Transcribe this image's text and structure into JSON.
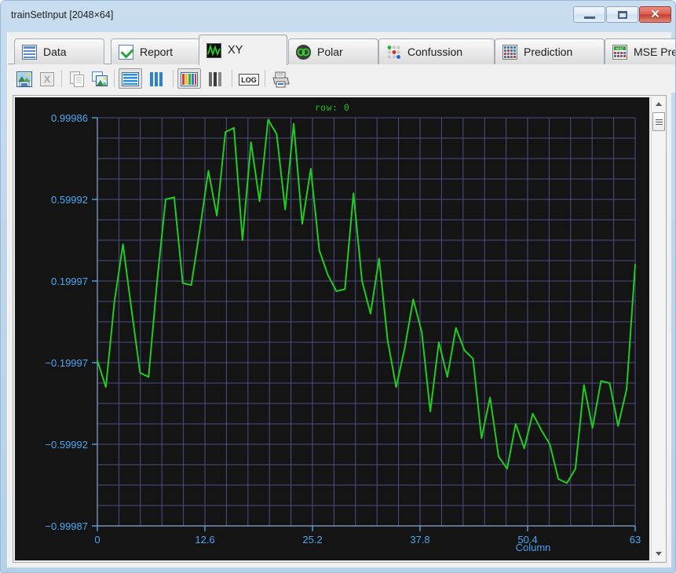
{
  "window": {
    "title": "trainSetInput [2048×64]",
    "buttons": {
      "minimize": "–",
      "maximize": "□",
      "close": "✕"
    }
  },
  "tabs": [
    {
      "id": "data",
      "label": "Data",
      "icon": "table-icon",
      "active": false
    },
    {
      "id": "report",
      "label": "Report",
      "icon": "check-icon",
      "active": false
    },
    {
      "id": "xy",
      "label": "XY",
      "icon": "xy-plot-icon",
      "active": true
    },
    {
      "id": "polar",
      "label": "Polar",
      "icon": "polar-icon",
      "active": false
    },
    {
      "id": "confussion",
      "label": "Confussion",
      "icon": "confusion-icon",
      "active": false
    },
    {
      "id": "prediction",
      "label": "Prediction",
      "icon": "prediction-icon",
      "active": false
    },
    {
      "id": "msepred",
      "label": "MSE Pred",
      "icon": "mse-icon",
      "active": false
    }
  ],
  "toolbar": [
    {
      "id": "save-image",
      "name": "save-image-button",
      "tooltip": "Save image",
      "enabled": true,
      "pressed": false
    },
    {
      "id": "export-excel",
      "name": "export-excel-button",
      "tooltip": "Export to Excel",
      "enabled": false,
      "pressed": false
    },
    {
      "id": "copy",
      "name": "copy-button",
      "tooltip": "Copy",
      "enabled": false,
      "pressed": false
    },
    {
      "id": "copy-image",
      "name": "copy-image-button",
      "tooltip": "Copy image",
      "enabled": true,
      "pressed": false
    },
    {
      "id": "lines-view",
      "name": "horizontal-lines-button",
      "tooltip": "Lines",
      "enabled": true,
      "pressed": true
    },
    {
      "id": "columns-view",
      "name": "vertical-bars-button",
      "tooltip": "Columns",
      "enabled": true,
      "pressed": false
    },
    {
      "id": "color-map",
      "name": "color-bars-button",
      "tooltip": "Color",
      "enabled": true,
      "pressed": true
    },
    {
      "id": "gray-map",
      "name": "gray-bars-button",
      "tooltip": "Grayscale",
      "enabled": true,
      "pressed": false
    },
    {
      "id": "log-scale",
      "name": "log-scale-button",
      "label": "LOG",
      "enabled": true,
      "pressed": false
    },
    {
      "id": "print",
      "name": "print-button",
      "tooltip": "Print",
      "enabled": true,
      "pressed": false
    }
  ],
  "scrollbar": {
    "up_arrow": "▲",
    "down_arrow": "▼",
    "position": "top"
  },
  "colors": {
    "plot_background": "#141414",
    "grid": "#4e4e86",
    "axis_text": "#4aa8f0",
    "series": "#1fcc1f",
    "annotation": "#18c21c",
    "title_bar": "#bfd6ec",
    "close_button": "#c63e2d"
  },
  "chart_data": {
    "type": "line",
    "title": "row: 0",
    "xlabel": "Column",
    "ylabel": "",
    "grid": true,
    "legend": false,
    "xlim": [
      0,
      63
    ],
    "ylim": [
      -0.99987,
      0.99986
    ],
    "xticks": [
      0,
      12.6,
      25.2,
      37.8,
      50.4,
      63
    ],
    "xtick_labels": [
      "0",
      "12.6",
      "25.2",
      "37.8",
      "50.4",
      "63"
    ],
    "yticks": [
      0.99986,
      0.59992,
      0.19997,
      -0.19997,
      -0.59992,
      -0.99987
    ],
    "ytick_labels": [
      "0.99986",
      "0.59992",
      "0.19997",
      "−0.19997",
      "−0.59992",
      "−0.99987"
    ],
    "series": [
      {
        "name": "row 0",
        "color": "#1fcc1f",
        "x": [
          0,
          1,
          2,
          3,
          4,
          5,
          6,
          7,
          8,
          9,
          10,
          11,
          12,
          13,
          14,
          15,
          16,
          17,
          18,
          19,
          20,
          21,
          22,
          23,
          24,
          25,
          26,
          27,
          28,
          29,
          30,
          31,
          32,
          33,
          34,
          35,
          36,
          37,
          38,
          39,
          40,
          41,
          42,
          43,
          44,
          45,
          46,
          47,
          48,
          49,
          50,
          51,
          52,
          53,
          54,
          55,
          56,
          57,
          58,
          59,
          60,
          61,
          62,
          63
        ],
        "values": [
          -0.19,
          -0.32,
          0.1,
          0.38,
          0.06,
          -0.25,
          -0.27,
          0.2,
          0.6,
          0.61,
          0.19,
          0.18,
          0.45,
          0.74,
          0.52,
          0.93,
          0.95,
          0.4,
          0.88,
          0.59,
          0.99,
          0.92,
          0.55,
          0.97,
          0.48,
          0.75,
          0.35,
          0.23,
          0.15,
          0.16,
          0.63,
          0.2,
          0.04,
          0.31,
          -0.09,
          -0.32,
          -0.13,
          0.11,
          -0.05,
          -0.44,
          -0.1,
          -0.27,
          -0.03,
          -0.14,
          -0.18,
          -0.57,
          -0.37,
          -0.66,
          -0.72,
          -0.5,
          -0.62,
          -0.45,
          -0.53,
          -0.6,
          -0.77,
          -0.79,
          -0.72,
          -0.31,
          -0.52,
          -0.29,
          -0.3,
          -0.51,
          -0.33,
          0.28
        ]
      }
    ]
  }
}
